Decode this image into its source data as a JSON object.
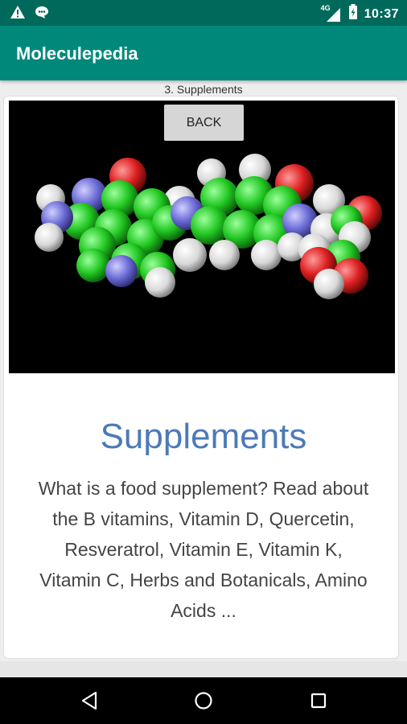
{
  "status_bar": {
    "time": "10:37",
    "network": "4G",
    "icons": [
      "warning-icon",
      "chat-icon",
      "signal-icon",
      "battery-icon"
    ]
  },
  "app_bar": {
    "title": "Moleculepedia"
  },
  "page": {
    "label": "3. Supplements",
    "back_label": "BACK",
    "heading": "Supplements",
    "description": "What is a food supplement? Read about the B vitamins, Vitamin D, Quercetin, Resveratrol, Vitamin E, Vitamin K, Vitamin C, Herbs and Botanicals, Amino Acids ..."
  },
  "nav_bar": {
    "icons": [
      "back-icon",
      "home-icon",
      "recents-icon"
    ]
  },
  "colors": {
    "status_bar": "#00695c",
    "app_bar": "#00897b",
    "heading": "#4c7ab8"
  }
}
